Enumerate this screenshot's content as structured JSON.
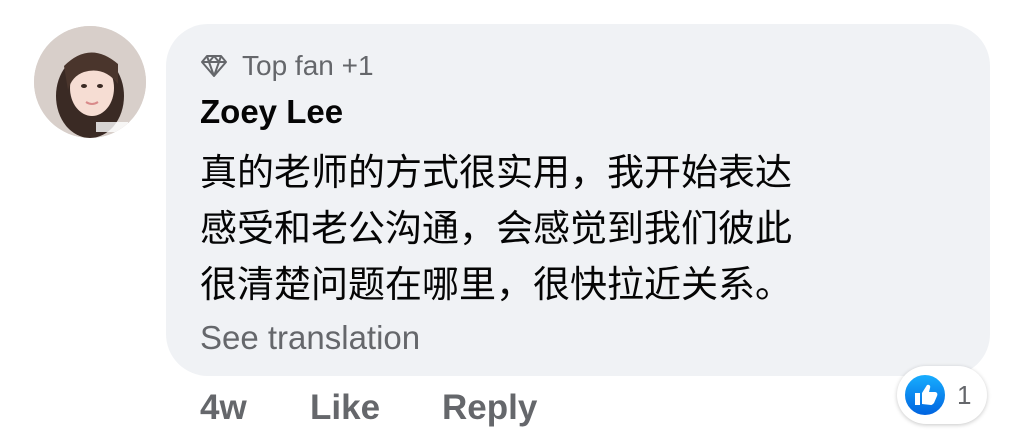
{
  "comment": {
    "author": {
      "name": "Zoey Lee",
      "badge": "Top fan +1",
      "badge_icon": "diamond-icon"
    },
    "text_lines": [
      "真的老师的方式很实用，我开始表达",
      "感受和老公沟通，会感觉到我们彼此",
      "很清楚问题在哪里，很快拉近关系。"
    ],
    "see_translation": "See translation",
    "reactions": {
      "icon": "like-icon",
      "count": "1",
      "color": "#1877f2"
    },
    "actions": {
      "time": "4w",
      "like": "Like",
      "reply": "Reply"
    }
  },
  "colors": {
    "bubble_bg": "#f0f2f5",
    "secondary_text": "#65676b",
    "primary_text": "#050505"
  }
}
